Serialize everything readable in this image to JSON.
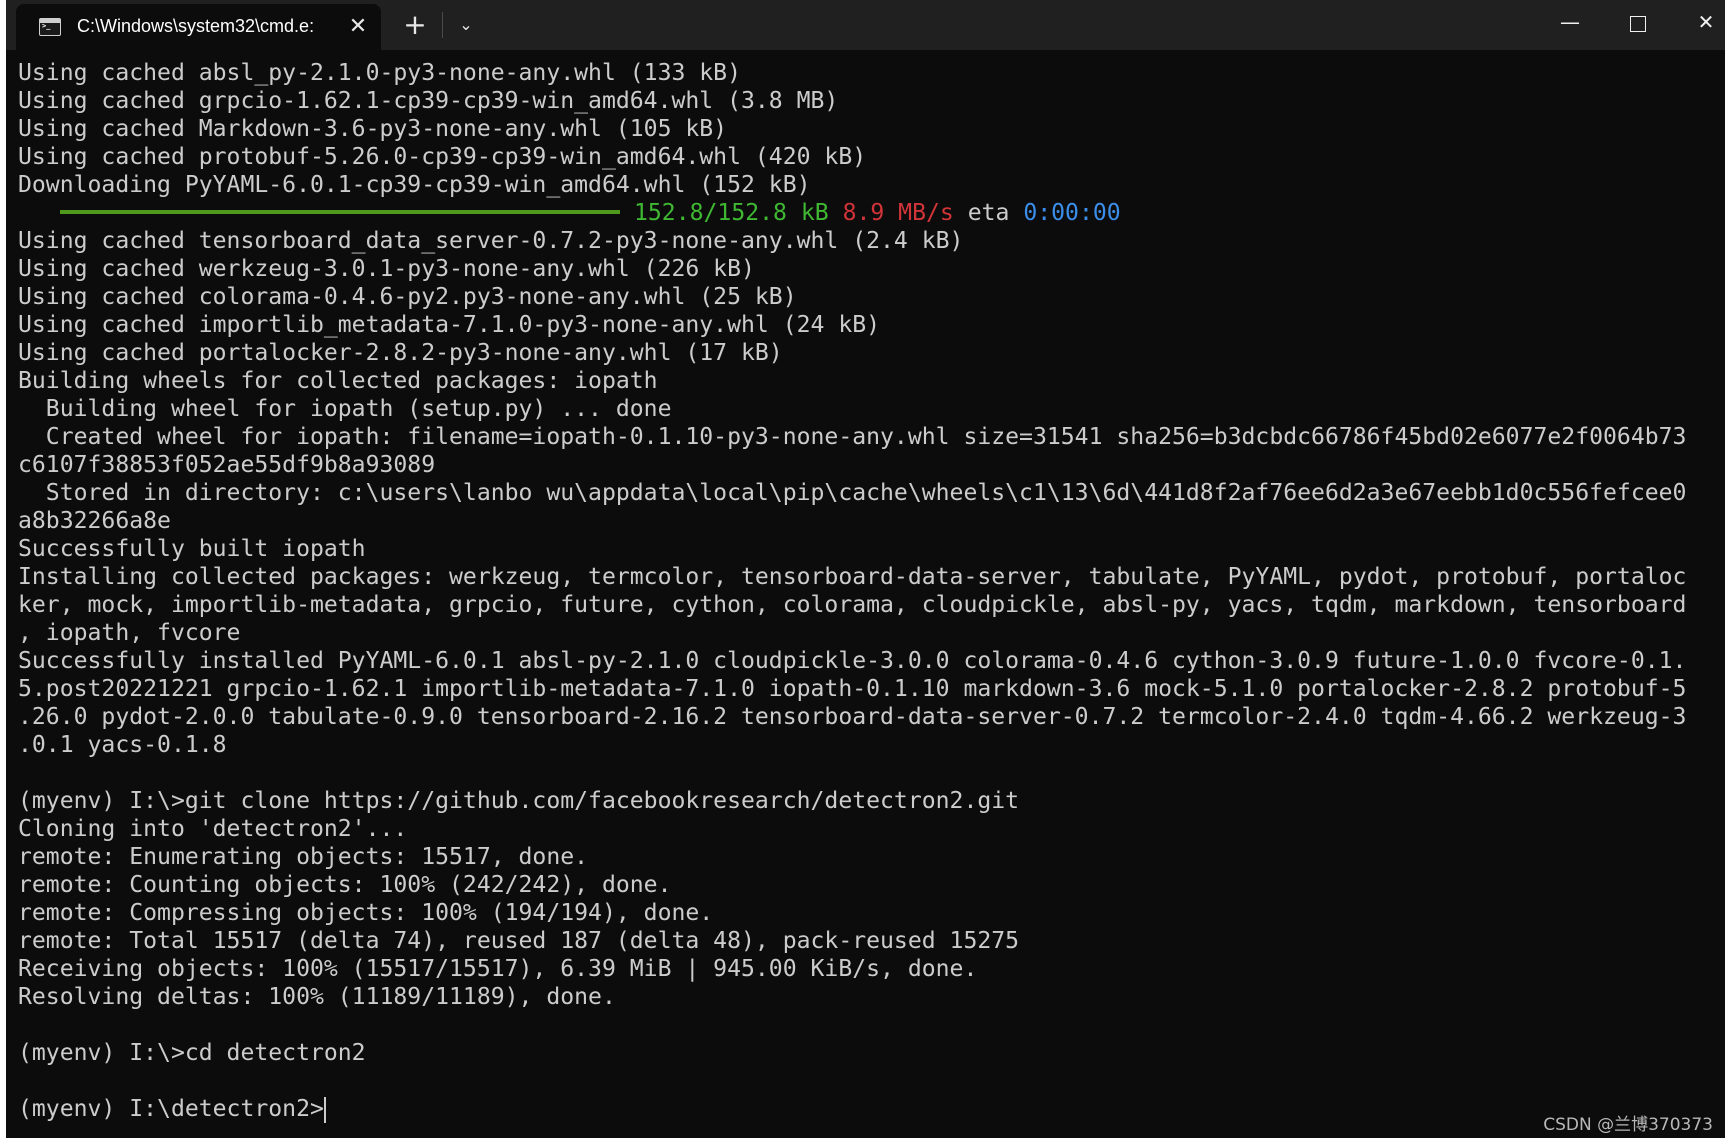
{
  "window": {
    "tab_title": "C:\\Windows\\system32\\cmd.e:",
    "tab_icon": "terminal-icon",
    "close_tab_glyph": "✕",
    "new_tab_glyph": "+",
    "dropdown_glyph": "⌄",
    "minimize_glyph": "—",
    "close_glyph": "✕"
  },
  "console": {
    "lines": [
      "Using cached absl_py-2.1.0-py3-none-any.whl (133 kB)",
      "Using cached grpcio-1.62.1-cp39-cp39-win_amd64.whl (3.8 MB)",
      "Using cached Markdown-3.6-py3-none-any.whl (105 kB)",
      "Using cached protobuf-5.26.0-cp39-cp39-win_amd64.whl (420 kB)",
      "Downloading PyYAML-6.0.1-cp39-cp39-win_amd64.whl (152 kB)"
    ],
    "progress": {
      "fraction": 1.0,
      "bar_color": "#4f9a1c",
      "size": "152.8/152.8 kB",
      "speed": "8.9 MB/s",
      "eta_label": "eta",
      "eta": "0:00:00"
    },
    "lines2": [
      "Using cached tensorboard_data_server-0.7.2-py3-none-any.whl (2.4 kB)",
      "Using cached werkzeug-3.0.1-py3-none-any.whl (226 kB)",
      "Using cached colorama-0.4.6-py2.py3-none-any.whl (25 kB)",
      "Using cached importlib_metadata-7.1.0-py3-none-any.whl (24 kB)",
      "Using cached portalocker-2.8.2-py3-none-any.whl (17 kB)",
      "Building wheels for collected packages: iopath",
      "  Building wheel for iopath (setup.py) ... done",
      "  Created wheel for iopath: filename=iopath-0.1.10-py3-none-any.whl size=31541 sha256=b3dcbdc66786f45bd02e6077e2f0064b73",
      "c6107f38853f052ae55df9b8a93089",
      "  Stored in directory: c:\\users\\lanbo wu\\appdata\\local\\pip\\cache\\wheels\\c1\\13\\6d\\441d8f2af76ee6d2a3e67eebb1d0c556fefcee0",
      "a8b32266a8e",
      "Successfully built iopath",
      "Installing collected packages: werkzeug, termcolor, tensorboard-data-server, tabulate, PyYAML, pydot, protobuf, portaloc",
      "ker, mock, importlib-metadata, grpcio, future, cython, colorama, cloudpickle, absl-py, yacs, tqdm, markdown, tensorboard",
      ", iopath, fvcore",
      "Successfully installed PyYAML-6.0.1 absl-py-2.1.0 cloudpickle-3.0.0 colorama-0.4.6 cython-3.0.9 future-1.0.0 fvcore-0.1.",
      "5.post20221221 grpcio-1.62.1 importlib-metadata-7.1.0 iopath-0.1.10 markdown-3.6 mock-5.1.0 portalocker-2.8.2 protobuf-5",
      ".26.0 pydot-2.0.0 tabulate-0.9.0 tensorboard-2.16.2 tensorboard-data-server-0.7.2 termcolor-2.4.0 tqdm-4.66.2 werkzeug-3",
      ".0.1 yacs-0.1.8",
      "",
      "(myenv) I:\\>git clone https://github.com/facebookresearch/detectron2.git",
      "Cloning into 'detectron2'...",
      "remote: Enumerating objects: 15517, done.",
      "remote: Counting objects: 100% (242/242), done.",
      "remote: Compressing objects: 100% (194/194), done.",
      "remote: Total 15517 (delta 74), reused 187 (delta 48), pack-reused 15275",
      "Receiving objects: 100% (15517/15517), 6.39 MiB | 945.00 KiB/s, done.",
      "Resolving deltas: 100% (11189/11189), done.",
      "",
      "(myenv) I:\\>cd detectron2",
      ""
    ],
    "prompt": "(myenv) I:\\detectron2>"
  },
  "watermark": "CSDN @兰博370373"
}
